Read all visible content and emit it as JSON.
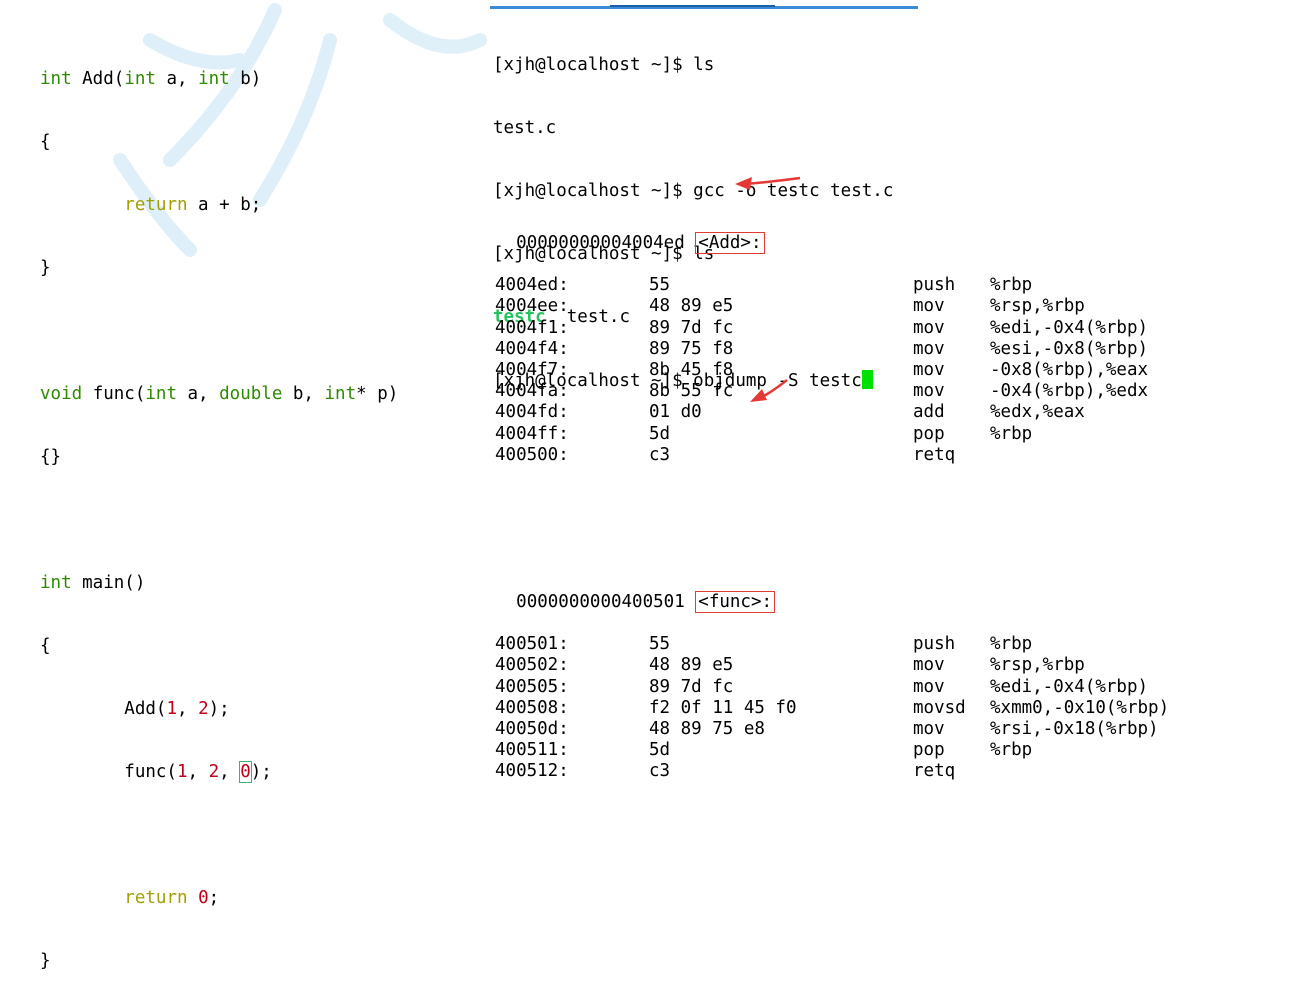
{
  "code": {
    "line1": {
      "kw1": "int",
      "t1": " Add(",
      "kw2": "int",
      "t2": " a, ",
      "kw3": "int",
      "t3": " b)"
    },
    "line2": "{",
    "line3": {
      "pre": "        ",
      "kw": "return",
      "rest": " a + b;"
    },
    "line4": "}",
    "line5": {
      "kw1": "void",
      "t1": " func(",
      "kw2": "int",
      "t2": " a, ",
      "kw3": "double",
      "t3": " b, ",
      "kw4": "int",
      "t4": "* p)"
    },
    "line6": "{}",
    "line7": {
      "kw": "int",
      "rest": " main()"
    },
    "line8": "{",
    "line9": {
      "pre": "        Add(",
      "n1": "1",
      "t1": ", ",
      "n2": "2",
      "t2": ");"
    },
    "line10": {
      "pre": "        func(",
      "n1": "1",
      "t1": ", ",
      "n2": "2",
      "t2": ", ",
      "n3": "0",
      "t3": ");"
    },
    "line11": {
      "pre": "        ",
      "kw": "return",
      "t1": " ",
      "n": "0",
      "t2": ";"
    },
    "line12": "}"
  },
  "terminal": {
    "l1": "[xjh@localhost ~]$ ls",
    "l2": "test.c",
    "l3": "[xjh@localhost ~]$ gcc -o testc test.c",
    "l4": "[xjh@localhost ~]$ ls",
    "l5_exe": "testc",
    "l5_file": "  test.c",
    "l6": "[xjh@localhost ~]$ objdump -S testc"
  },
  "dump": {
    "add_addr": "00000000004004ed ",
    "add_label": "<Add>:",
    "add_rows": [
      {
        "addr": "4004ed:",
        "bytes": "55",
        "op": "push",
        "args": "%rbp"
      },
      {
        "addr": "4004ee:",
        "bytes": "48 89 e5",
        "op": "mov",
        "args": "%rsp,%rbp"
      },
      {
        "addr": "4004f1:",
        "bytes": "89 7d fc",
        "op": "mov",
        "args": "%edi,-0x4(%rbp)"
      },
      {
        "addr": "4004f4:",
        "bytes": "89 75 f8",
        "op": "mov",
        "args": "%esi,-0x8(%rbp)"
      },
      {
        "addr": "4004f7:",
        "bytes": "8b 45 f8",
        "op": "mov",
        "args": "-0x8(%rbp),%eax"
      },
      {
        "addr": "4004fa:",
        "bytes": "8b 55 fc",
        "op": "mov",
        "args": "-0x4(%rbp),%edx"
      },
      {
        "addr": "4004fd:",
        "bytes": "01 d0",
        "op": "add",
        "args": "%edx,%eax"
      },
      {
        "addr": "4004ff:",
        "bytes": "5d",
        "op": "pop",
        "args": "%rbp"
      },
      {
        "addr": "400500:",
        "bytes": "c3",
        "op": "retq",
        "args": ""
      }
    ],
    "func_addr": "0000000000400501 ",
    "func_label": "<func>:",
    "func_rows": [
      {
        "addr": "400501:",
        "bytes": "55",
        "op": "push",
        "args": "%rbp"
      },
      {
        "addr": "400502:",
        "bytes": "48 89 e5",
        "op": "mov",
        "args": "%rsp,%rbp"
      },
      {
        "addr": "400505:",
        "bytes": "89 7d fc",
        "op": "mov",
        "args": "%edi,-0x4(%rbp)"
      },
      {
        "addr": "400508:",
        "bytes": "f2 0f 11 45 f0",
        "op": "movsd",
        "args": "%xmm0,-0x10(%rbp)"
      },
      {
        "addr": "40050d:",
        "bytes": "48 89 75 e8",
        "op": "mov",
        "args": "%rsi,-0x18(%rbp)"
      },
      {
        "addr": "400511:",
        "bytes": "5d",
        "op": "pop",
        "args": "%rbp"
      },
      {
        "addr": "400512:",
        "bytes": "c3",
        "op": "retq",
        "args": ""
      }
    ]
  },
  "colors": {
    "annotation": "#e53935",
    "terminal_bar": "#3a8ad6",
    "exe_green": "#22c55e"
  }
}
